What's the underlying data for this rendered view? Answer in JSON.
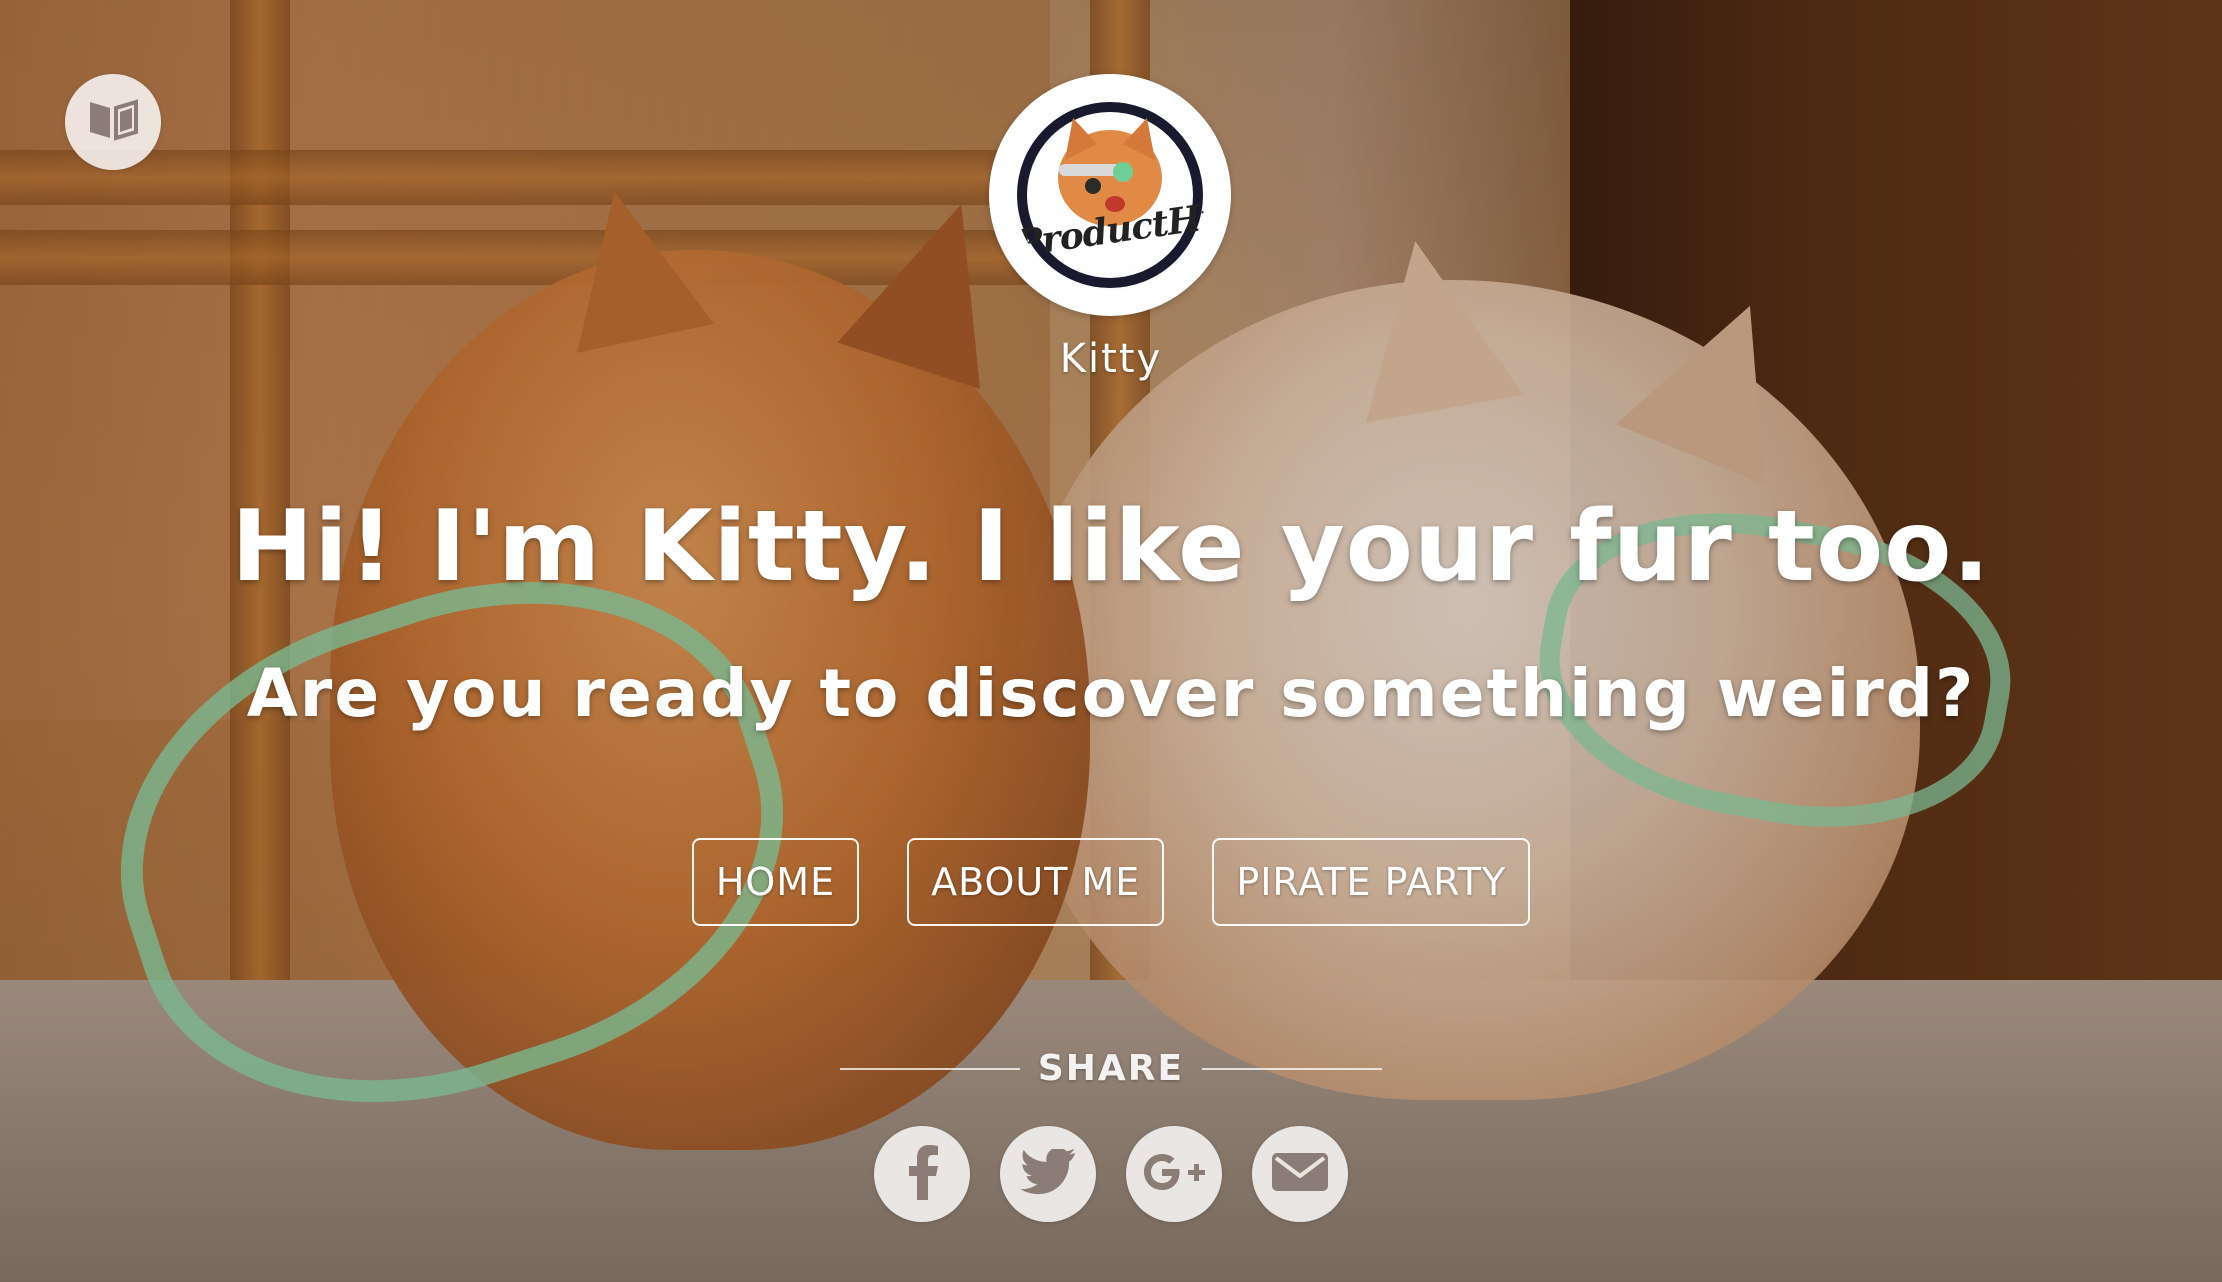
{
  "site": {
    "name": "Kitty",
    "avatar_logo_text": "ProductHunt"
  },
  "hero": {
    "headline": "Hi! I'm Kitty. I like your fur too.",
    "subheadline": "Are you ready to discover something weird?"
  },
  "nav": {
    "items": [
      {
        "label": "HOME"
      },
      {
        "label": "ABOUT ME"
      },
      {
        "label": "PIRATE PARTY"
      }
    ]
  },
  "share": {
    "label": "SHARE",
    "buttons": [
      {
        "icon": "facebook-icon",
        "glyph": "f"
      },
      {
        "icon": "twitter-icon",
        "glyph": "🐦"
      },
      {
        "icon": "google-plus-icon",
        "glyph": "G+"
      },
      {
        "icon": "email-icon",
        "glyph": "✉"
      }
    ]
  },
  "toggle": {
    "icon": "book-icon"
  },
  "colors": {
    "text": "#ffffff",
    "button_bg": "#ffffffd1",
    "icon_gray": "#8b7d75"
  }
}
